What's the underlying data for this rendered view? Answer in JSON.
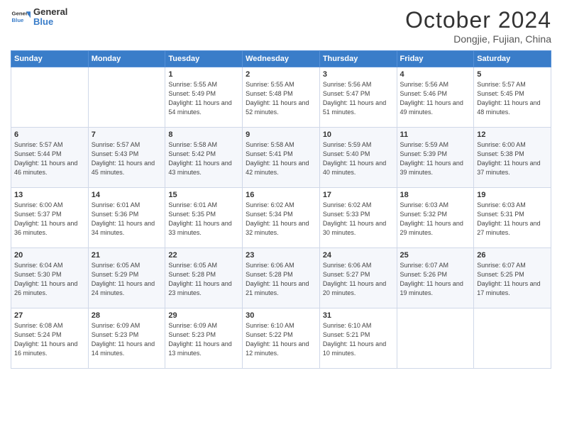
{
  "header": {
    "logo_line1": "General",
    "logo_line2": "Blue",
    "month_title": "October 2024",
    "location": "Dongjie, Fujian, China"
  },
  "weekdays": [
    "Sunday",
    "Monday",
    "Tuesday",
    "Wednesday",
    "Thursday",
    "Friday",
    "Saturday"
  ],
  "weeks": [
    [
      {
        "day": "",
        "info": ""
      },
      {
        "day": "",
        "info": ""
      },
      {
        "day": "1",
        "info": "Sunrise: 5:55 AM\nSunset: 5:49 PM\nDaylight: 11 hours and 54 minutes."
      },
      {
        "day": "2",
        "info": "Sunrise: 5:55 AM\nSunset: 5:48 PM\nDaylight: 11 hours and 52 minutes."
      },
      {
        "day": "3",
        "info": "Sunrise: 5:56 AM\nSunset: 5:47 PM\nDaylight: 11 hours and 51 minutes."
      },
      {
        "day": "4",
        "info": "Sunrise: 5:56 AM\nSunset: 5:46 PM\nDaylight: 11 hours and 49 minutes."
      },
      {
        "day": "5",
        "info": "Sunrise: 5:57 AM\nSunset: 5:45 PM\nDaylight: 11 hours and 48 minutes."
      }
    ],
    [
      {
        "day": "6",
        "info": "Sunrise: 5:57 AM\nSunset: 5:44 PM\nDaylight: 11 hours and 46 minutes."
      },
      {
        "day": "7",
        "info": "Sunrise: 5:57 AM\nSunset: 5:43 PM\nDaylight: 11 hours and 45 minutes."
      },
      {
        "day": "8",
        "info": "Sunrise: 5:58 AM\nSunset: 5:42 PM\nDaylight: 11 hours and 43 minutes."
      },
      {
        "day": "9",
        "info": "Sunrise: 5:58 AM\nSunset: 5:41 PM\nDaylight: 11 hours and 42 minutes."
      },
      {
        "day": "10",
        "info": "Sunrise: 5:59 AM\nSunset: 5:40 PM\nDaylight: 11 hours and 40 minutes."
      },
      {
        "day": "11",
        "info": "Sunrise: 5:59 AM\nSunset: 5:39 PM\nDaylight: 11 hours and 39 minutes."
      },
      {
        "day": "12",
        "info": "Sunrise: 6:00 AM\nSunset: 5:38 PM\nDaylight: 11 hours and 37 minutes."
      }
    ],
    [
      {
        "day": "13",
        "info": "Sunrise: 6:00 AM\nSunset: 5:37 PM\nDaylight: 11 hours and 36 minutes."
      },
      {
        "day": "14",
        "info": "Sunrise: 6:01 AM\nSunset: 5:36 PM\nDaylight: 11 hours and 34 minutes."
      },
      {
        "day": "15",
        "info": "Sunrise: 6:01 AM\nSunset: 5:35 PM\nDaylight: 11 hours and 33 minutes."
      },
      {
        "day": "16",
        "info": "Sunrise: 6:02 AM\nSunset: 5:34 PM\nDaylight: 11 hours and 32 minutes."
      },
      {
        "day": "17",
        "info": "Sunrise: 6:02 AM\nSunset: 5:33 PM\nDaylight: 11 hours and 30 minutes."
      },
      {
        "day": "18",
        "info": "Sunrise: 6:03 AM\nSunset: 5:32 PM\nDaylight: 11 hours and 29 minutes."
      },
      {
        "day": "19",
        "info": "Sunrise: 6:03 AM\nSunset: 5:31 PM\nDaylight: 11 hours and 27 minutes."
      }
    ],
    [
      {
        "day": "20",
        "info": "Sunrise: 6:04 AM\nSunset: 5:30 PM\nDaylight: 11 hours and 26 minutes."
      },
      {
        "day": "21",
        "info": "Sunrise: 6:05 AM\nSunset: 5:29 PM\nDaylight: 11 hours and 24 minutes."
      },
      {
        "day": "22",
        "info": "Sunrise: 6:05 AM\nSunset: 5:28 PM\nDaylight: 11 hours and 23 minutes."
      },
      {
        "day": "23",
        "info": "Sunrise: 6:06 AM\nSunset: 5:28 PM\nDaylight: 11 hours and 21 minutes."
      },
      {
        "day": "24",
        "info": "Sunrise: 6:06 AM\nSunset: 5:27 PM\nDaylight: 11 hours and 20 minutes."
      },
      {
        "day": "25",
        "info": "Sunrise: 6:07 AM\nSunset: 5:26 PM\nDaylight: 11 hours and 19 minutes."
      },
      {
        "day": "26",
        "info": "Sunrise: 6:07 AM\nSunset: 5:25 PM\nDaylight: 11 hours and 17 minutes."
      }
    ],
    [
      {
        "day": "27",
        "info": "Sunrise: 6:08 AM\nSunset: 5:24 PM\nDaylight: 11 hours and 16 minutes."
      },
      {
        "day": "28",
        "info": "Sunrise: 6:09 AM\nSunset: 5:23 PM\nDaylight: 11 hours and 14 minutes."
      },
      {
        "day": "29",
        "info": "Sunrise: 6:09 AM\nSunset: 5:23 PM\nDaylight: 11 hours and 13 minutes."
      },
      {
        "day": "30",
        "info": "Sunrise: 6:10 AM\nSunset: 5:22 PM\nDaylight: 11 hours and 12 minutes."
      },
      {
        "day": "31",
        "info": "Sunrise: 6:10 AM\nSunset: 5:21 PM\nDaylight: 11 hours and 10 minutes."
      },
      {
        "day": "",
        "info": ""
      },
      {
        "day": "",
        "info": ""
      }
    ]
  ]
}
